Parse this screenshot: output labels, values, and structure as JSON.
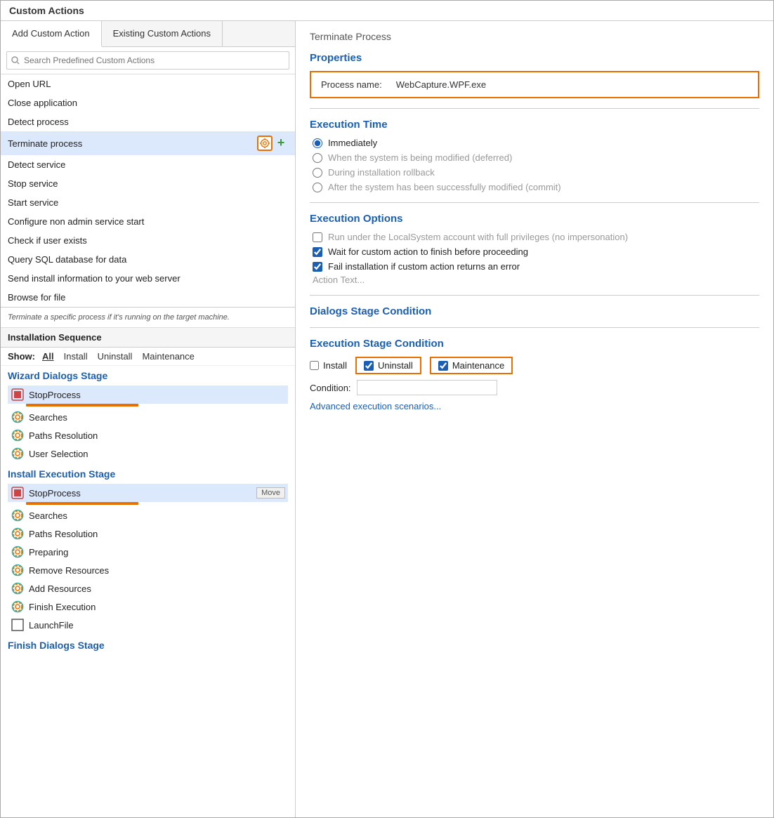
{
  "app": {
    "title": "Custom Actions"
  },
  "tabs": {
    "add_label": "Add Custom Action",
    "existing_label": "Existing Custom Actions",
    "active": "add"
  },
  "search": {
    "placeholder": "Search Predefined Custom Actions"
  },
  "action_list": {
    "items": [
      {
        "label": "Open URL",
        "selected": false
      },
      {
        "label": "Close application",
        "selected": false
      },
      {
        "label": "Detect process",
        "selected": false
      },
      {
        "label": "Terminate process",
        "selected": true
      },
      {
        "label": "Detect service",
        "selected": false
      },
      {
        "label": "Stop service",
        "selected": false
      },
      {
        "label": "Start service",
        "selected": false
      },
      {
        "label": "Configure non admin service start",
        "selected": false
      },
      {
        "label": "Check if user exists",
        "selected": false
      },
      {
        "label": "Query SQL database for data",
        "selected": false
      },
      {
        "label": "Send install information to your web server",
        "selected": false
      },
      {
        "label": "Browse for file",
        "selected": false
      }
    ],
    "description": "Terminate a specific process if it's running on the target machine."
  },
  "installation_sequence": {
    "header": "Installation Sequence",
    "show_label": "Show:",
    "show_options": [
      "All",
      "Install",
      "Uninstall",
      "Maintenance"
    ],
    "show_active": "All"
  },
  "wizard_dialogs_stage": {
    "title": "Wizard Dialogs Stage",
    "items": [
      {
        "label": "StopProcess",
        "type": "stop-process",
        "has_bar": true
      },
      {
        "label": "Searches",
        "type": "gear"
      },
      {
        "label": "Paths Resolution",
        "type": "gear"
      },
      {
        "label": "User Selection",
        "type": "gear"
      }
    ]
  },
  "install_execution_stage": {
    "title": "Install Execution Stage",
    "items": [
      {
        "label": "StopProcess",
        "type": "stop-process",
        "has_bar": true,
        "has_move": true,
        "move_label": "Move"
      },
      {
        "label": "Searches",
        "type": "gear"
      },
      {
        "label": "Paths Resolution",
        "type": "gear"
      },
      {
        "label": "Preparing",
        "type": "gear"
      },
      {
        "label": "Remove Resources",
        "type": "gear"
      },
      {
        "label": "Add Resources",
        "type": "gear"
      },
      {
        "label": "Finish Execution",
        "type": "gear"
      },
      {
        "label": "LaunchFile",
        "type": "square"
      }
    ]
  },
  "finish_dialogs_stage": {
    "title": "Finish Dialogs Stage"
  },
  "right_panel": {
    "title": "Terminate Process",
    "properties": {
      "section_title": "Properties",
      "process_name_label": "Process name:",
      "process_name_value": "WebCapture.WPF.exe"
    },
    "execution_time": {
      "section_title": "Execution Time",
      "options": [
        {
          "label": "Immediately",
          "selected": true,
          "disabled": false
        },
        {
          "label": "When the system is being modified (deferred)",
          "selected": false,
          "disabled": true
        },
        {
          "label": "During installation rollback",
          "selected": false,
          "disabled": true
        },
        {
          "label": "After the system has been successfully modified (commit)",
          "selected": false,
          "disabled": true
        }
      ]
    },
    "execution_options": {
      "section_title": "Execution Options",
      "checkboxes": [
        {
          "label": "Run under the LocalSystem account with full privileges (no impersonation)",
          "checked": false,
          "disabled": true
        },
        {
          "label": "Wait for custom action to finish before proceeding",
          "checked": true,
          "disabled": false
        },
        {
          "label": "Fail installation if custom action returns an error",
          "checked": true,
          "disabled": false
        }
      ],
      "action_text": "Action Text..."
    },
    "dialogs_stage_condition": {
      "section_title": "Dialogs Stage Condition"
    },
    "execution_stage_condition": {
      "section_title": "Execution Stage Condition",
      "install_label": "Install",
      "install_checked": false,
      "uninstall_label": "Uninstall",
      "uninstall_checked": true,
      "maintenance_label": "Maintenance",
      "maintenance_checked": true,
      "condition_label": "Condition:",
      "condition_value": "",
      "advanced_link": "Advanced execution scenarios..."
    }
  }
}
